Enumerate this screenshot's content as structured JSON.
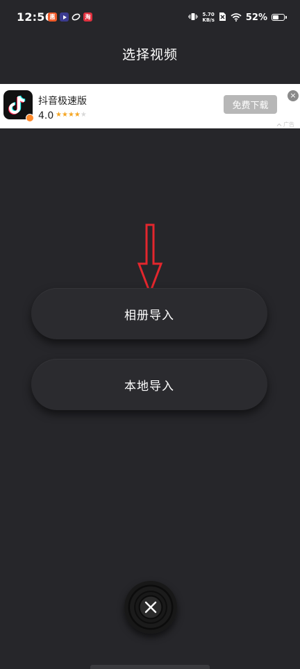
{
  "status_bar": {
    "time": "12:56",
    "net_speed_value": "5.70",
    "net_speed_unit": "KB/s",
    "battery_percent": "52%",
    "battery_level": 0.52,
    "notification_icons": [
      "orange-app-icon",
      "play-app-icon",
      "sync-app-icon",
      "red-app-icon"
    ]
  },
  "header": {
    "title": "选择视频"
  },
  "ad": {
    "app_name": "抖音极速版",
    "rating": "4.0",
    "stars_filled": 4,
    "stars_total": 5,
    "download_label": "免费下载",
    "ad_label": "广告",
    "close_glyph": "×",
    "button_color": "#b7b7b7"
  },
  "main": {
    "album_import_label": "相册导入",
    "local_import_label": "本地导入",
    "arrow_color": "#e3262d"
  },
  "footer": {
    "close_glyph": "×"
  }
}
